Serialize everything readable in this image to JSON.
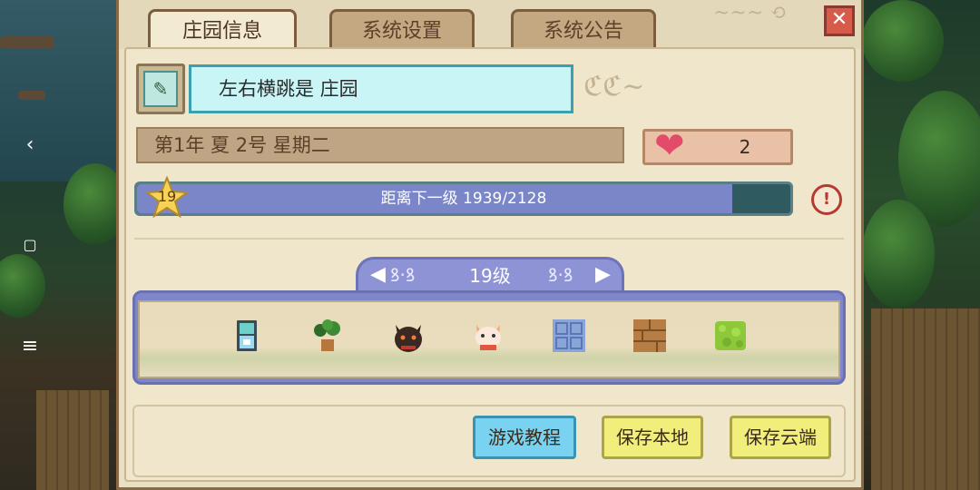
{
  "tabs": [
    {
      "label": "庄园信息",
      "active": true
    },
    {
      "label": "系统设置",
      "active": false
    },
    {
      "label": "系统公告",
      "active": false
    }
  ],
  "close_label": "✕",
  "farm": {
    "name": "左右横跳是 庄园",
    "date": "第1年  夏  2号  星期二",
    "hearts": "2"
  },
  "level": {
    "current": "19",
    "xp_text": "距离下一级   1939/2128",
    "progress": 0.911,
    "badge_label": "19级"
  },
  "items": [
    {
      "icon": "storage-box-icon"
    },
    {
      "icon": "potted-plant-icon"
    },
    {
      "icon": "black-cat-icon"
    },
    {
      "icon": "lucky-cat-icon"
    },
    {
      "icon": "blue-tile-icon"
    },
    {
      "icon": "wood-crate-icon"
    },
    {
      "icon": "green-bush-icon"
    }
  ],
  "buttons": {
    "tutorial": "游戏教程",
    "save_local": "保存本地",
    "save_cloud": "保存云端"
  },
  "colors": {
    "accent_blue": "#79d2ef",
    "accent_yellow": "#f1ee7b",
    "xp_fill": "#7a86c8",
    "heart": "#e24b6a"
  }
}
